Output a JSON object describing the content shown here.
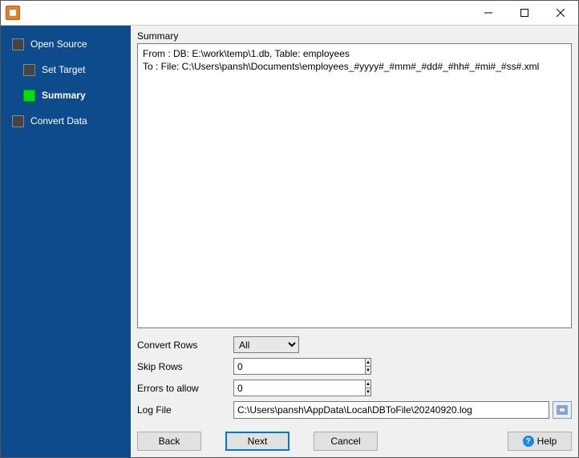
{
  "titlebar": {
    "title": ""
  },
  "sidebar": {
    "items": [
      {
        "label": "Open Source",
        "active": false
      },
      {
        "label": "Set Target",
        "active": false
      },
      {
        "label": "Summary",
        "active": true
      },
      {
        "label": "Convert Data",
        "active": false
      }
    ]
  },
  "main": {
    "summary_label": "Summary",
    "summary_text": "From : DB: E:\\work\\temp\\1.db, Table: employees\nTo : File: C:\\Users\\pansh\\Documents\\employees_#yyyy#_#mm#_#dd#_#hh#_#mi#_#ss#.xml",
    "form": {
      "convert_rows_label": "Convert Rows",
      "convert_rows_value": "All",
      "skip_rows_label": "Skip Rows",
      "skip_rows_value": "0",
      "errors_label": "Errors to allow",
      "errors_value": "0",
      "log_file_label": "Log File",
      "log_file_value": "C:\\Users\\pansh\\AppData\\Local\\DBToFile\\20240920.log"
    },
    "buttons": {
      "back": "Back",
      "next": "Next",
      "cancel": "Cancel",
      "help": "Help"
    }
  }
}
